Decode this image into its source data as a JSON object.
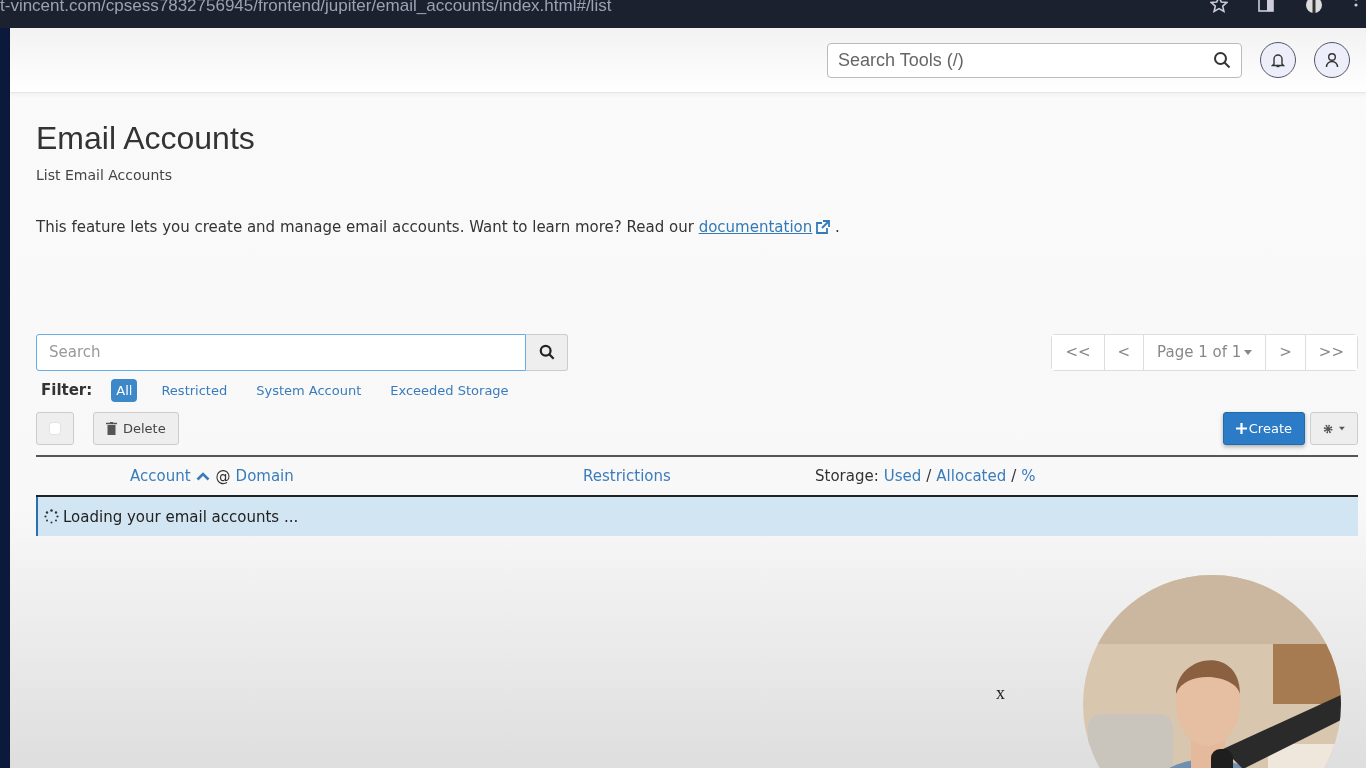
{
  "browser": {
    "url": "t-vincent.com/cpsess7832756945/frontend/jupiter/email_accounts/index.html#/list"
  },
  "header": {
    "search_placeholder": "Search Tools (/)"
  },
  "page": {
    "title": "Email Accounts",
    "subtitle": "List Email Accounts",
    "description": "This feature lets you create and manage email accounts. Want to learn more? Read our",
    "link": "documentation",
    "after_link": "."
  },
  "search": {
    "placeholder": "Search"
  },
  "pagination": [
    {
      "label": "<<",
      "kind": "button"
    },
    {
      "label": "<",
      "kind": "button"
    },
    {
      "label": "Page 1 of 1",
      "kind": "dropdown"
    },
    {
      "label": ">",
      "kind": "button"
    },
    {
      "label": ">>",
      "kind": "button"
    }
  ],
  "filter": {
    "label": "Filter:",
    "options": [
      {
        "label": "All",
        "selected": true
      },
      {
        "label": "Restricted",
        "selected": false
      },
      {
        "label": "System Account",
        "selected": false
      },
      {
        "label": "Exceeded Storage",
        "selected": false
      }
    ]
  },
  "toolbar": {
    "select_all_checked": false,
    "delete": "Delete",
    "create": "Create"
  },
  "columns": [
    {
      "parts": [
        {
          "text": "Account",
          "kind": "link",
          "sort_ascending": true
        },
        {
          "text": "@",
          "kind": "text"
        },
        {
          "text": "Domain",
          "kind": "link"
        }
      ]
    },
    {
      "parts": [
        {
          "text": "Restrictions",
          "kind": "link"
        }
      ]
    },
    {
      "parts": [
        {
          "text": "Storage:",
          "kind": "text"
        },
        {
          "text": "Used",
          "kind": "link"
        },
        {
          "text": "/",
          "kind": "text"
        },
        {
          "text": "Allocated",
          "kind": "link"
        },
        {
          "text": "/",
          "kind": "text"
        },
        {
          "text": "%",
          "kind": "link"
        }
      ]
    }
  ],
  "status": {
    "message": "Loading your email accounts ..."
  },
  "overlay_mark": "x"
}
